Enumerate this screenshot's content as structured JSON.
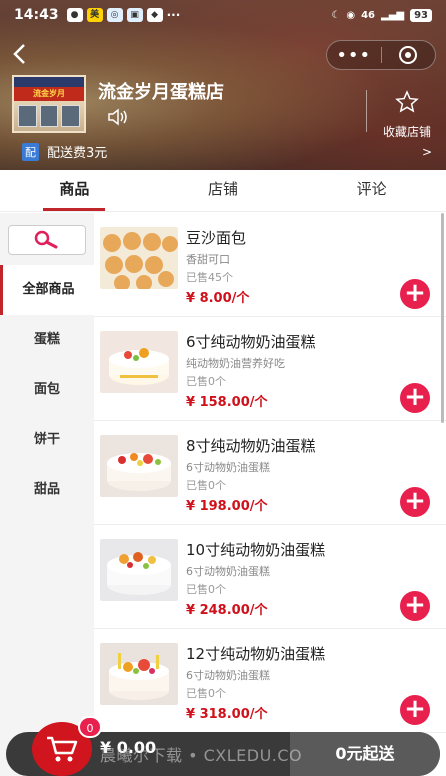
{
  "status_bar": {
    "time": "14:43",
    "network_label": "46",
    "battery": "93"
  },
  "header": {
    "shop_name": "流金岁月蛋糕店",
    "logo_sign": "流金岁月",
    "favorite_label": "收藏店铺",
    "delivery_tag": "配",
    "delivery_text": "配送费3元",
    "delivery_chevron": ">"
  },
  "tabs": [
    {
      "label": "商品",
      "active": true
    },
    {
      "label": "店铺",
      "active": false
    },
    {
      "label": "评论",
      "active": false
    }
  ],
  "sidebar": {
    "categories": [
      {
        "label": "全部商品",
        "active": true
      },
      {
        "label": "蛋糕",
        "active": false
      },
      {
        "label": "面包",
        "active": false
      },
      {
        "label": "饼干",
        "active": false
      },
      {
        "label": "甜品",
        "active": false
      }
    ]
  },
  "products": [
    {
      "name": "豆沙面包",
      "desc": "香甜可口",
      "sold": "已售45个",
      "price": "¥ 8.00/个"
    },
    {
      "name": "6寸纯动物奶油蛋糕",
      "desc": "纯动物奶油营养好吃",
      "sold": "已售0个",
      "price": "¥ 158.00/个"
    },
    {
      "name": "8寸纯动物奶油蛋糕",
      "desc": "6寸动物奶油蛋糕",
      "sold": "已售0个",
      "price": "¥ 198.00/个"
    },
    {
      "name": "10寸纯动物奶油蛋糕",
      "desc": "6寸动物奶油蛋糕",
      "sold": "已售0个",
      "price": "¥ 248.00/个"
    },
    {
      "name": "12寸纯动物奶油蛋糕",
      "desc": "6寸动物奶油蛋糕",
      "sold": "已售0个",
      "price": "¥ 318.00/个"
    }
  ],
  "bottom_bar": {
    "cart_count": "0",
    "total": "¥ 0.00",
    "checkout_label": "0元起送",
    "watermark": "晨曦尔下载 • CXLEDU.CO"
  },
  "colors": {
    "accent": "#c0252a",
    "price": "#d0101a",
    "add_button": "#e8204e",
    "delivery_tag": "#3a7bd5"
  }
}
